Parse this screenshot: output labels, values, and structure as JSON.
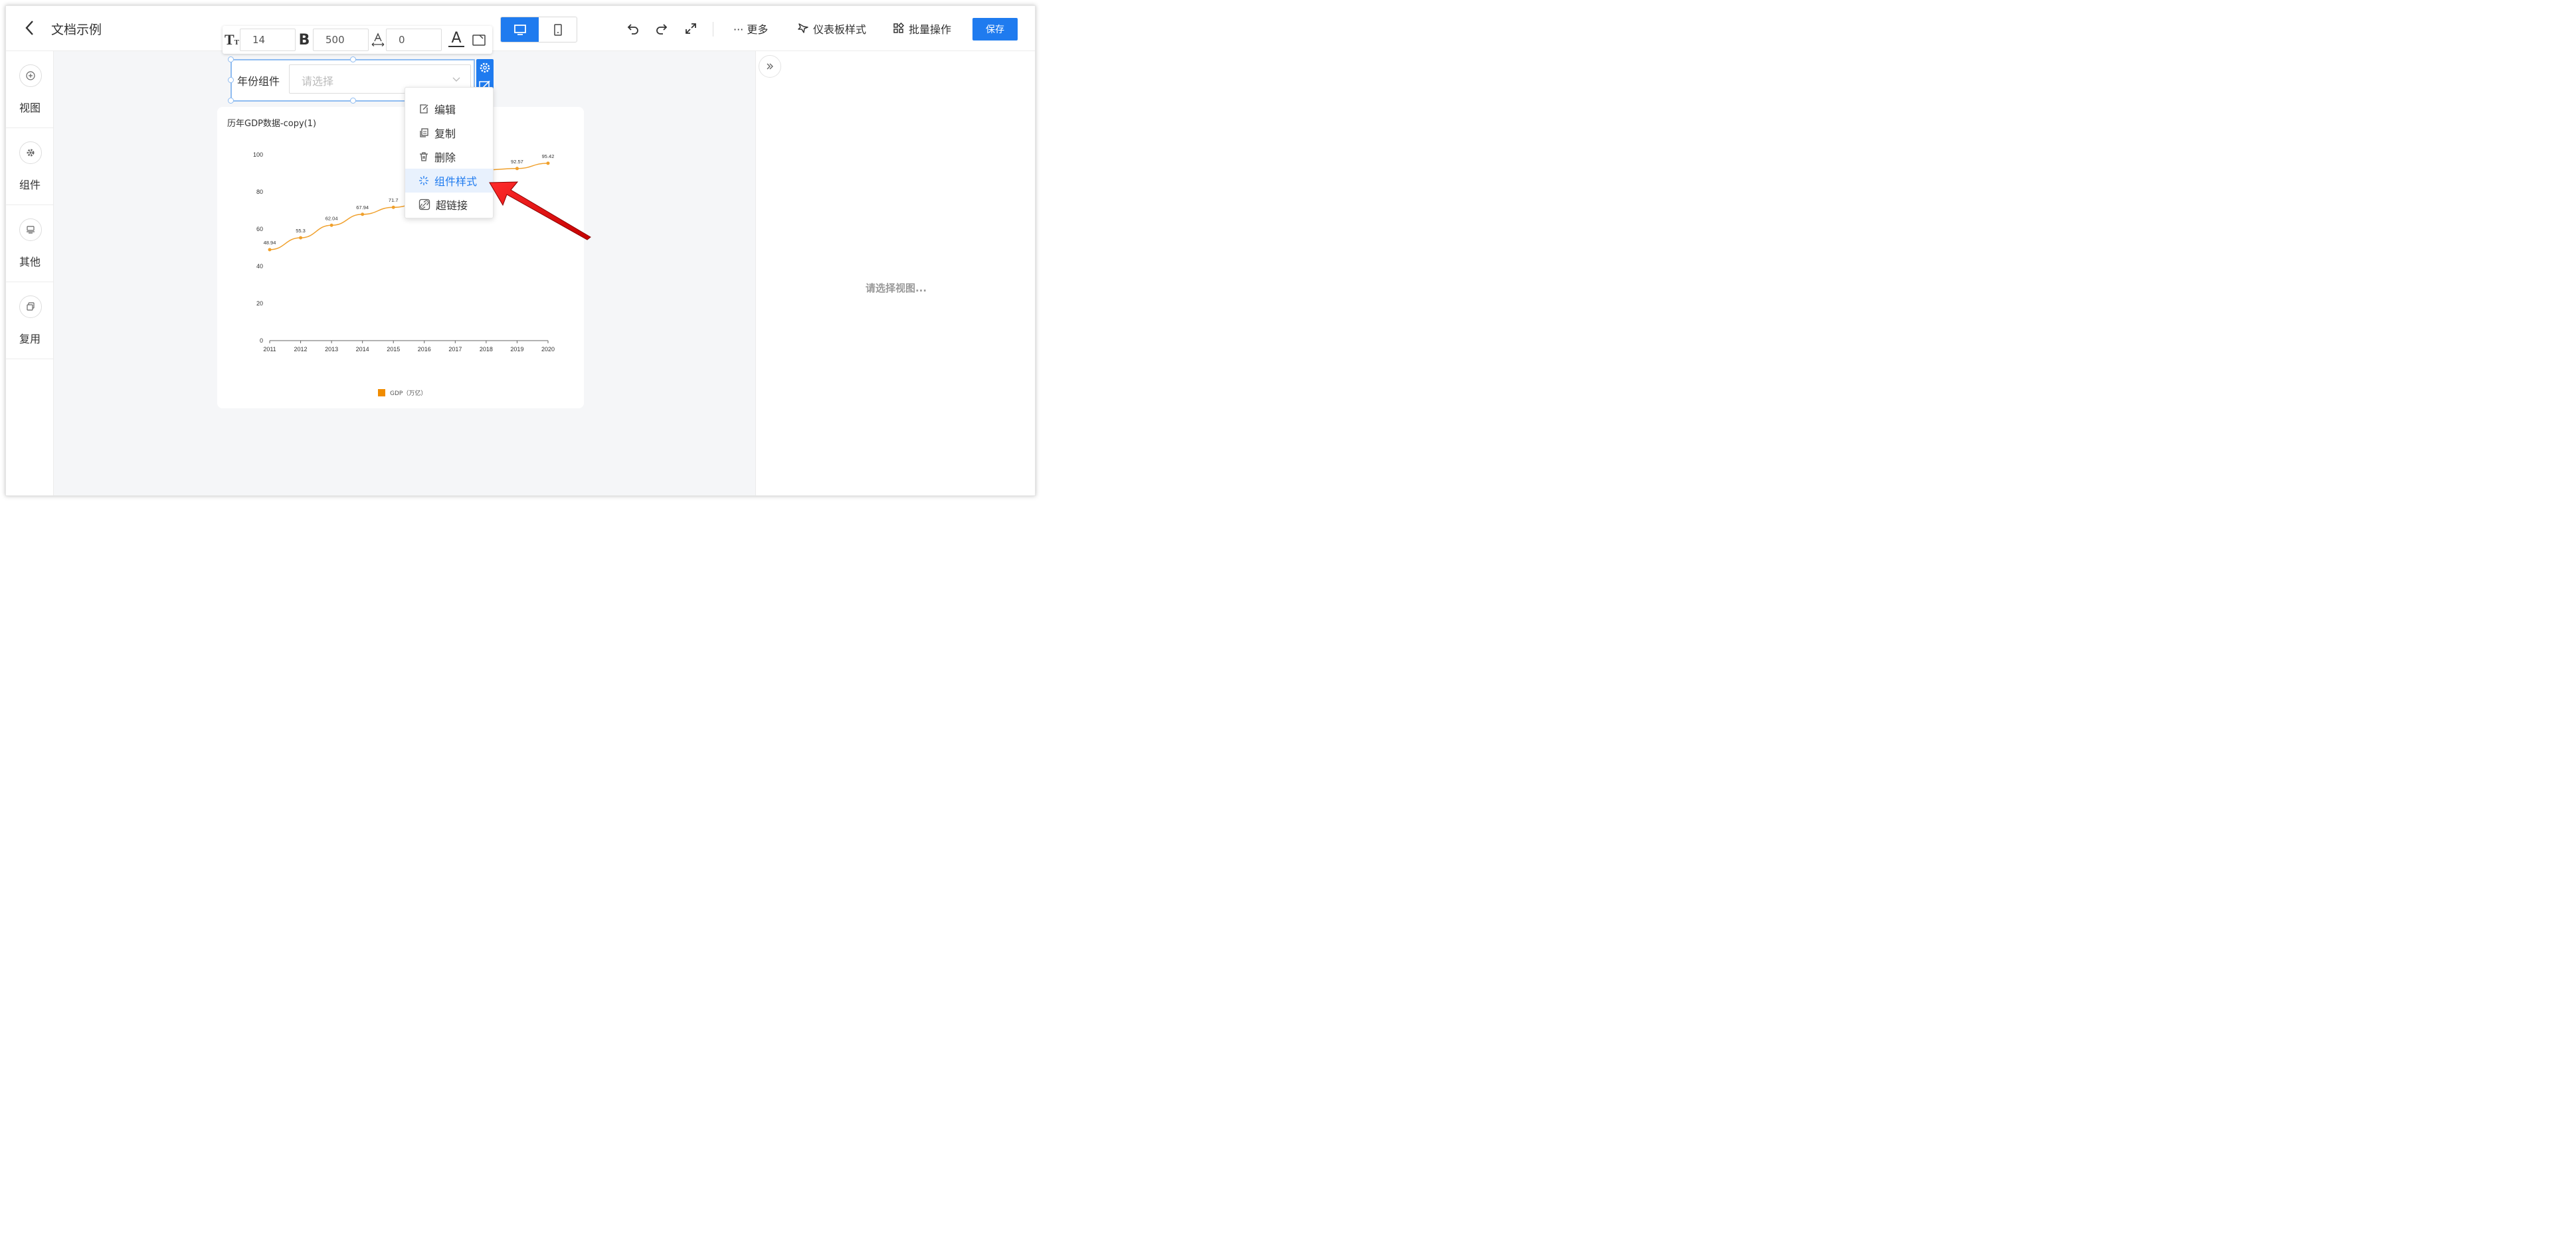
{
  "header": {
    "back_icon": "chevron-left-icon",
    "title": "文档示例",
    "device_modes": [
      {
        "name": "desktop",
        "icon": "monitor-icon",
        "active": true
      },
      {
        "name": "mobile",
        "icon": "phone-icon",
        "active": false
      }
    ],
    "more_label": "··· 更多",
    "dashboard_style_label": "仪表板样式",
    "batch_ops_label": "批量操作",
    "save_label": "保存",
    "accent_color": "#1f7bef"
  },
  "sidebar": {
    "items": [
      {
        "label": "视图",
        "icon": "plus-circle-icon"
      },
      {
        "label": "组件",
        "icon": "gear-icon"
      },
      {
        "label": "其他",
        "icon": "stamp-icon"
      },
      {
        "label": "复用",
        "icon": "copy-icon"
      }
    ]
  },
  "style_toolbar": {
    "font_size": "14",
    "font_weight": "500",
    "letter_spacing": "0"
  },
  "year_widget": {
    "label": "年份组件",
    "placeholder": "请选择"
  },
  "context_menu": {
    "items": [
      {
        "label": "编辑",
        "icon": "edit-icon",
        "active": false
      },
      {
        "label": "复制",
        "icon": "duplicate-icon",
        "active": false
      },
      {
        "label": "删除",
        "icon": "trash-icon",
        "active": false
      },
      {
        "label": "组件样式",
        "icon": "sparkle-icon",
        "active": true
      },
      {
        "label": "超链接",
        "icon": "link-icon",
        "active": false
      }
    ]
  },
  "right_panel": {
    "empty_hint": "请选择视图..."
  },
  "chart_card": {
    "title": "历年GDP数据-copy(1)"
  },
  "chart_data": {
    "type": "line",
    "title": "历年GDP数据-copy(1)",
    "x": [
      "2011",
      "2012",
      "2013",
      "2014",
      "2015",
      "2016",
      "2017",
      "2018",
      "2019",
      "2020"
    ],
    "series": [
      {
        "name": "GDP（万亿）",
        "values": [
          48.94,
          55.3,
          62.04,
          67.94,
          71.7,
          74.6,
          83.2,
          91.9,
          92.57,
          95.42
        ],
        "labels": [
          "48.94",
          "55.3",
          "62.04",
          "67.94",
          "71.7",
          "",
          "",
          "",
          "92.57",
          "95.42"
        ],
        "color": "#f0a02c"
      }
    ],
    "ylim": [
      0,
      100
    ],
    "yticks": [
      "0",
      "20",
      "40",
      "60",
      "80",
      "100"
    ],
    "legend": "bottom-center",
    "grid": false
  }
}
